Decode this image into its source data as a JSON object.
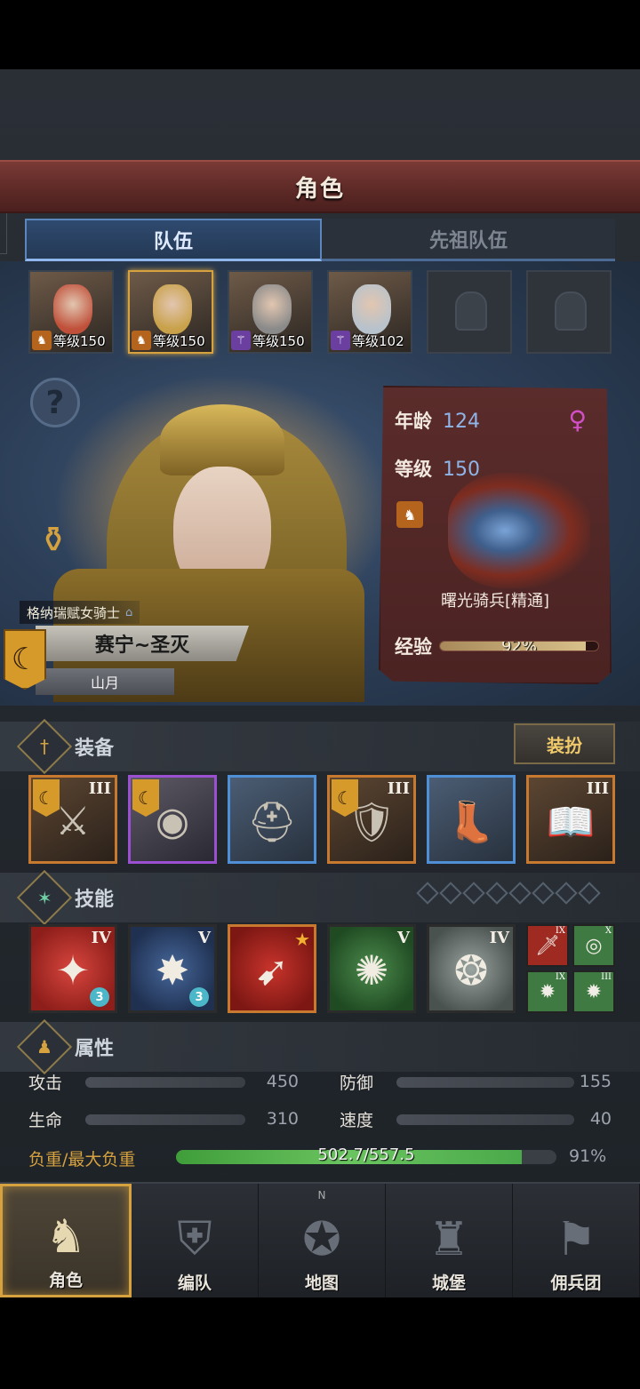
{
  "title": "角色",
  "tabs": {
    "team": "队伍",
    "ancestor_team": "先祖队伍"
  },
  "party": [
    {
      "level_label": "等级150",
      "class": "cavalry",
      "selected": false,
      "color": "#c0503a"
    },
    {
      "level_label": "等级150",
      "class": "cavalry",
      "selected": true,
      "color": "#c9a14a"
    },
    {
      "level_label": "等级150",
      "class": "mage",
      "selected": false,
      "color": "#8a8a8a"
    },
    {
      "level_label": "等级102",
      "class": "mage",
      "selected": false,
      "color": "#b7c2cc"
    },
    {
      "level_label": "",
      "class": "",
      "selected": false,
      "empty": true
    },
    {
      "level_label": "",
      "class": "",
      "selected": false,
      "empty": true
    }
  ],
  "hero": {
    "class_title": "格纳瑞赋女骑士",
    "name": "赛宁~圣灭",
    "month": "山月",
    "faction_glyph": "☾"
  },
  "info": {
    "age_label": "年龄",
    "age": "124",
    "level_label": "等级",
    "level": "150",
    "gender_glyph": "♀",
    "unit_name": "曙光骑兵[精通]",
    "exp_label": "经验",
    "exp_pct_text": "92%",
    "exp_fraction": 0.92
  },
  "equipment": {
    "title": "装备",
    "dress_button": "装扮",
    "items": [
      {
        "name": "weapon",
        "tier": "III",
        "flag": true,
        "rarity": "orange",
        "glyph": "⚔"
      },
      {
        "name": "shield",
        "tier": "",
        "flag": true,
        "rarity": "purple",
        "glyph": "◉"
      },
      {
        "name": "helmet",
        "tier": "",
        "flag": false,
        "rarity": "blue",
        "glyph": "⛑"
      },
      {
        "name": "armor",
        "tier": "III",
        "flag": true,
        "rarity": "orange",
        "glyph": "🛡"
      },
      {
        "name": "boots",
        "tier": "",
        "flag": false,
        "rarity": "blue",
        "glyph": "👢"
      },
      {
        "name": "book",
        "tier": "III",
        "flag": false,
        "rarity": "orange",
        "glyph": "📖"
      }
    ]
  },
  "skills": {
    "title": "技能",
    "slots_total": 8,
    "items": [
      {
        "tier": "IV",
        "style": "red",
        "glyph": "✦",
        "badge": "3"
      },
      {
        "tier": "V",
        "style": "blue",
        "glyph": "✸",
        "badge": "3"
      },
      {
        "tier": "★",
        "style": "red2",
        "glyph": "➹",
        "badge": ""
      },
      {
        "tier": "V",
        "style": "green",
        "glyph": "✺",
        "badge": ""
      },
      {
        "tier": "IV",
        "style": "gray",
        "glyph": "❂",
        "badge": ""
      }
    ],
    "mini": [
      {
        "tier": "IX",
        "style": "r",
        "glyph": "🗡"
      },
      {
        "tier": "X",
        "style": "g",
        "glyph": "◎"
      },
      {
        "tier": "IX",
        "style": "g",
        "glyph": "✹"
      },
      {
        "tier": "III",
        "style": "g",
        "glyph": "✹"
      }
    ]
  },
  "attributes": {
    "title": "属性",
    "attack_label": "攻击",
    "attack": "450",
    "defense_label": "防御",
    "defense": "155",
    "hp_label": "生命",
    "hp": "310",
    "speed_label": "速度",
    "speed": "40",
    "load_label": "负重/最大负重",
    "load_text": "502.7/557.5",
    "load_pct_text": "91%",
    "load_fraction": 0.91
  },
  "nav": [
    {
      "label": "角色",
      "glyph": "♞",
      "active": true
    },
    {
      "label": "编队",
      "glyph": "⛨",
      "active": false
    },
    {
      "label": "地图",
      "glyph": "✪",
      "active": false,
      "compass": "N"
    },
    {
      "label": "城堡",
      "glyph": "♜",
      "active": false
    },
    {
      "label": "佣兵团",
      "glyph": "⚑",
      "active": false
    }
  ]
}
